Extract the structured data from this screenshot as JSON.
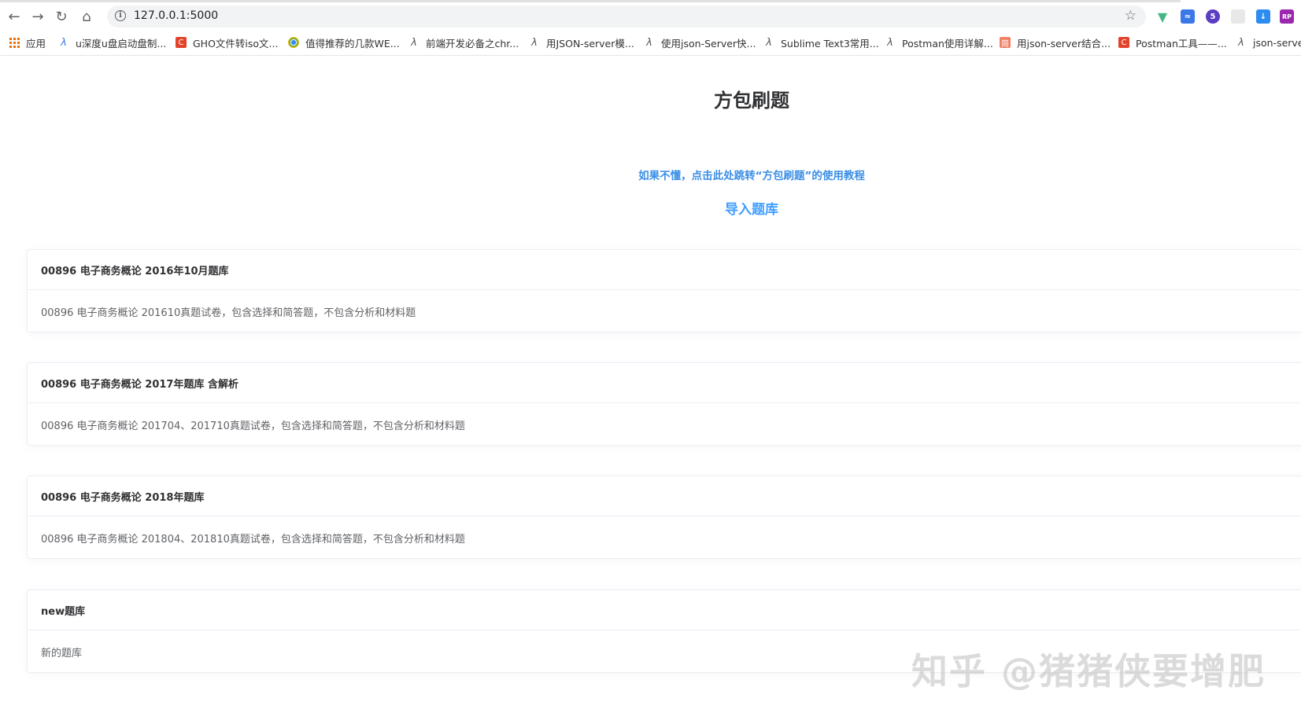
{
  "browser": {
    "url": "127.0.0.1:5000",
    "bookmarks": [
      {
        "label": "应用",
        "icon": "apps-grid-icon"
      },
      {
        "label": "u深度u盘启动盘制...",
        "icon": "udeep-icon"
      },
      {
        "label": "GHO文件转iso文...",
        "icon": "csdn-icon"
      },
      {
        "label": "值得推荐的几款WE...",
        "icon": "chrome-icon"
      },
      {
        "label": "前端开发必备之chr...",
        "icon": "script-icon"
      },
      {
        "label": "用JSON-server模...",
        "icon": "script-icon"
      },
      {
        "label": "使用json-Server快...",
        "icon": "script-icon"
      },
      {
        "label": "Sublime Text3常用...",
        "icon": "script-icon"
      },
      {
        "label": "Postman使用详解...",
        "icon": "script-icon"
      },
      {
        "label": "用json-server结合...",
        "icon": "jianshu-icon"
      },
      {
        "label": "Postman工具——...",
        "icon": "csdn-icon"
      },
      {
        "label": "json-serve",
        "icon": "script-icon"
      }
    ],
    "extensions": [
      {
        "icon": "vue-devtools-icon",
        "color": "#41b883"
      },
      {
        "icon": "chart-extension-icon",
        "color": "#3b78e7"
      },
      {
        "icon": "extension-badge-icon",
        "color": "#5b3cc4",
        "badge": "5"
      },
      {
        "icon": "blank-extension-icon",
        "color": "#dddddd"
      },
      {
        "icon": "download-extension-icon",
        "color": "#2d8cf0"
      },
      {
        "icon": "rp-extension-icon",
        "color": "#9b27af",
        "label": "RP"
      }
    ]
  },
  "page": {
    "title": "方包刷题",
    "tutorial_link": "如果不懂，点击此处跳转“方包刷题”的使用教程",
    "import_link": "导入题库"
  },
  "banks": [
    {
      "title": "00896 电子商务概论 2016年10月题库",
      "description": "00896 电子商务概论 201610真题试卷，包含选择和简答题，不包含分析和材料题"
    },
    {
      "title": "00896 电子商务概论 2017年题库 含解析",
      "description": "00896 电子商务概论 201704、201710真题试卷，包含选择和简答题，不包含分析和材料题"
    },
    {
      "title": "00896 电子商务概论 2018年题库",
      "description": "00896 电子商务概论 201804、201810真题试卷，包含选择和简答题，不包含分析和材料题"
    },
    {
      "title": "new题库",
      "description": "新的题库"
    }
  ],
  "watermark": "知乎 @猪猪侠要增肥"
}
